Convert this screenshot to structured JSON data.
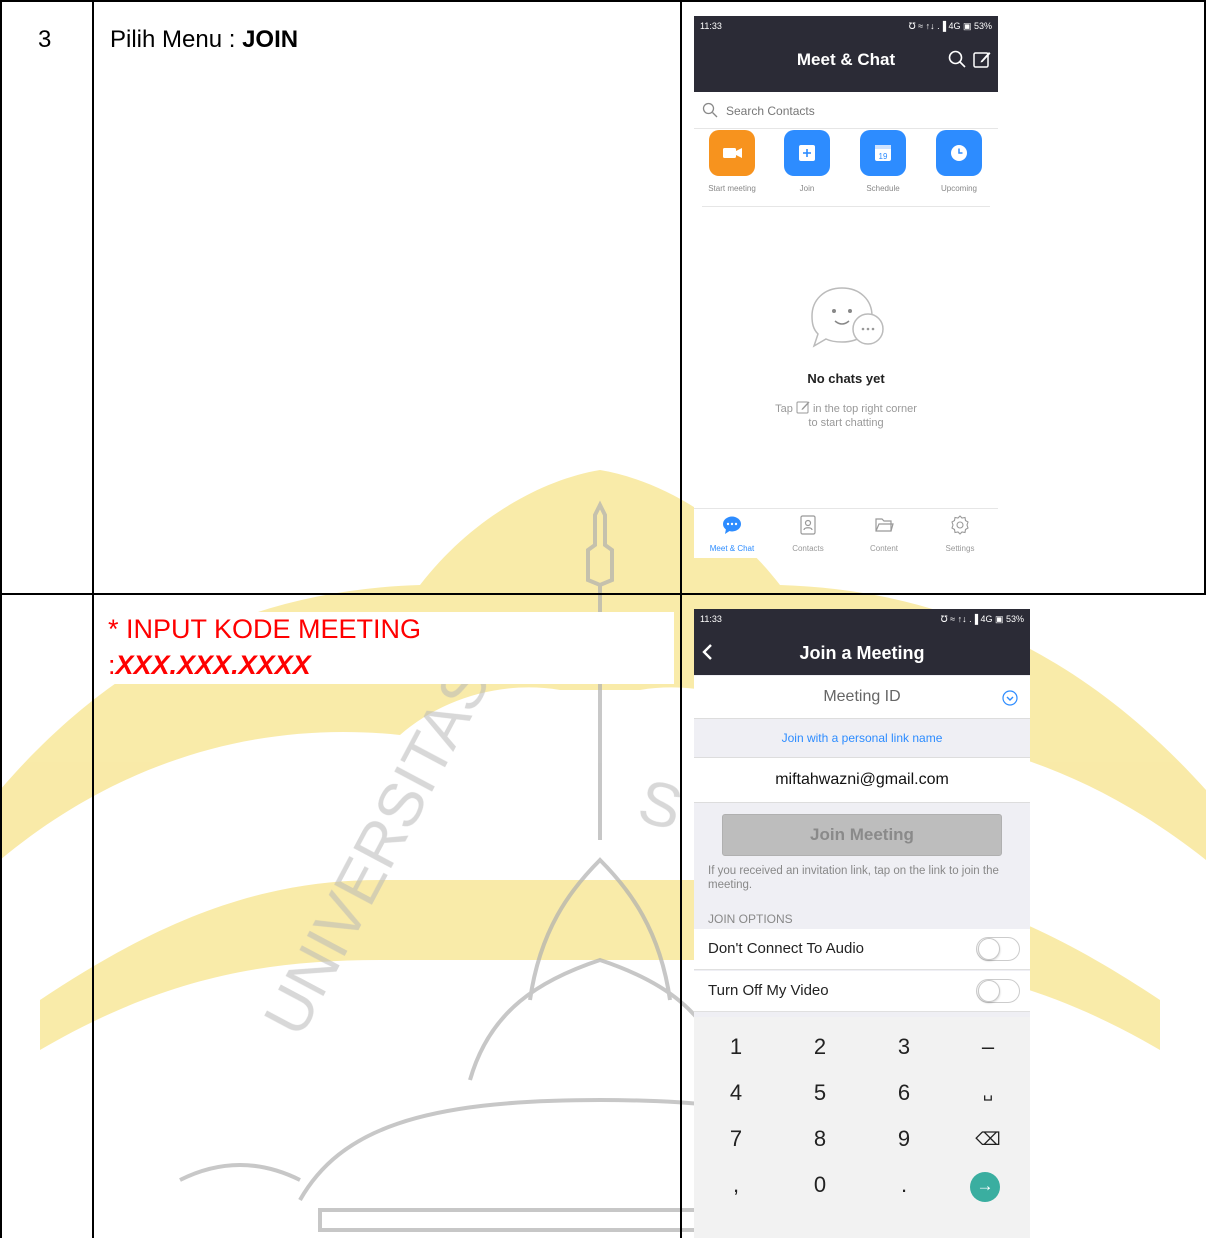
{
  "table": {
    "row1": {
      "number": "3",
      "instruction_prefix": "Pilih Menu : ",
      "instruction_bold": "JOIN"
    },
    "row2": {
      "note_line1": "* INPUT KODE MEETING",
      "note_colon": ":",
      "note_code": "XXX.XXX.XXXX"
    }
  },
  "watermark": {
    "text_left": "UNIVERSITAS",
    "text_right": "S",
    "color": "#f7e38a"
  },
  "phone1": {
    "status": {
      "time": "11:33",
      "right": "℧ ≈ ↑↓ .▐ 4G ▣ 53%"
    },
    "title": "Meet & Chat",
    "search_placeholder": "Search Contacts",
    "actions": [
      {
        "label": "Start meeting",
        "icon": "video-camera-icon",
        "color": "#f7931e"
      },
      {
        "label": "Join",
        "icon": "plus-icon",
        "color": "#2d8cff"
      },
      {
        "label": "Schedule",
        "icon": "calendar-icon",
        "color": "#2d8cff"
      },
      {
        "label": "Upcoming",
        "icon": "clock-icon",
        "color": "#2d8cff"
      }
    ],
    "empty_title": "No chats yet",
    "empty_tip_pre": "Tap",
    "empty_tip_post": "in the top right corner",
    "empty_tip_line2": "to start chatting",
    "tabs": [
      {
        "label": "Meet & Chat",
        "icon": "chat-bubble-icon",
        "active": true
      },
      {
        "label": "Contacts",
        "icon": "contacts-icon",
        "active": false
      },
      {
        "label": "Content",
        "icon": "folder-icon",
        "active": false
      },
      {
        "label": "Settings",
        "icon": "gear-icon",
        "active": false
      }
    ],
    "accent": "#2d8cff",
    "header_color": "#2b2b36"
  },
  "phone2": {
    "status": {
      "time": "11:33",
      "right": "℧ ≈ ↑↓ .▐ 4G ▣ 53%"
    },
    "title": "Join a Meeting",
    "meeting_id_placeholder": "Meeting ID",
    "personal_link": "Join with a personal link name",
    "name_value": "miftahwazni@gmail.com",
    "join_button": "Join Meeting",
    "hint": "If you received an invitation link, tap on the link to join the meeting.",
    "options_header": "JOIN OPTIONS",
    "options": [
      {
        "label": "Don't Connect To Audio",
        "on": false
      },
      {
        "label": "Turn Off My Video",
        "on": false
      }
    ],
    "keypad": [
      "1",
      "2",
      "3",
      "–",
      "4",
      "5",
      "6",
      "␣",
      "7",
      "8",
      "9",
      "⌫",
      ",",
      "0",
      ".",
      "→"
    ]
  }
}
